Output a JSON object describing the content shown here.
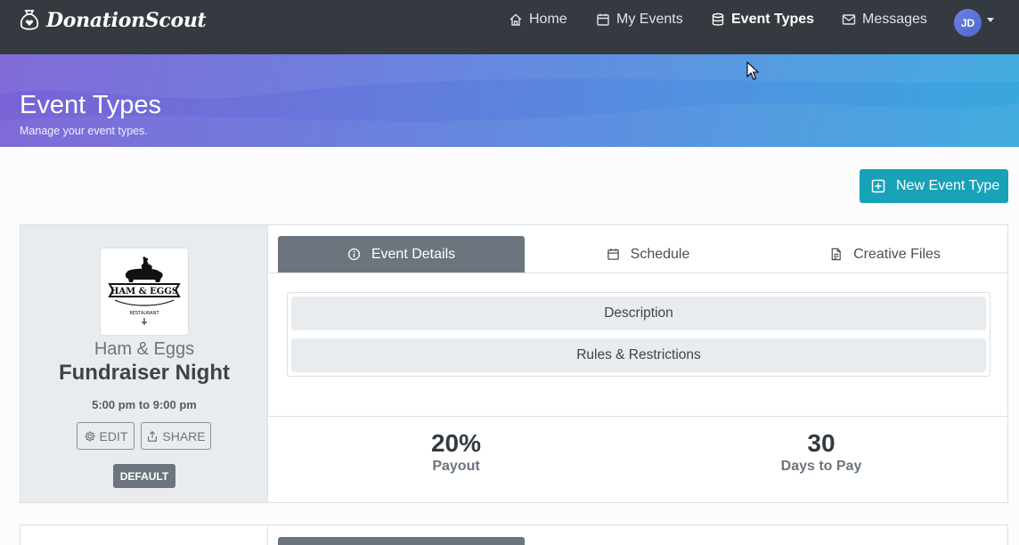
{
  "brand": {
    "name": "DonationScout"
  },
  "nav": {
    "items": [
      {
        "label": "Home",
        "icon": "home-icon"
      },
      {
        "label": "My Events",
        "icon": "calendar-icon"
      },
      {
        "label": "Event Types",
        "icon": "database-icon",
        "active": true
      },
      {
        "label": "Messages",
        "icon": "envelope-icon"
      }
    ],
    "user_initials": "JD"
  },
  "header": {
    "title": "Event Types",
    "subtitle": "Manage your event types."
  },
  "actions": {
    "new_event_type_label": "New Event Type"
  },
  "event_card": {
    "business_name": "Ham & Eggs",
    "event_name": "Fundraiser Night",
    "time": "5:00 pm to 9:00 pm",
    "edit_label": "EDIT",
    "share_label": "SHARE",
    "badge": "DEFAULT",
    "logo": {
      "line1": "HAM & EGGS",
      "line2": "RESTAURANT"
    },
    "tabs": [
      {
        "label": "Event Details",
        "icon": "info-circle-icon",
        "active": true
      },
      {
        "label": "Schedule",
        "icon": "calendar-icon"
      },
      {
        "label": "Creative Files",
        "icon": "file-icon"
      }
    ],
    "accordion": [
      {
        "label": "Description"
      },
      {
        "label": "Rules & Restrictions"
      }
    ],
    "stats": [
      {
        "value": "20%",
        "label": "Payout"
      },
      {
        "value": "30",
        "label": "Days to Pay"
      }
    ]
  },
  "colors": {
    "navbar": "#343a40",
    "primary_button": "#17a2b8",
    "active_tab": "#6c757d",
    "header_gradient_start": "#7a62d6",
    "header_gradient_end": "#38a8dd"
  }
}
